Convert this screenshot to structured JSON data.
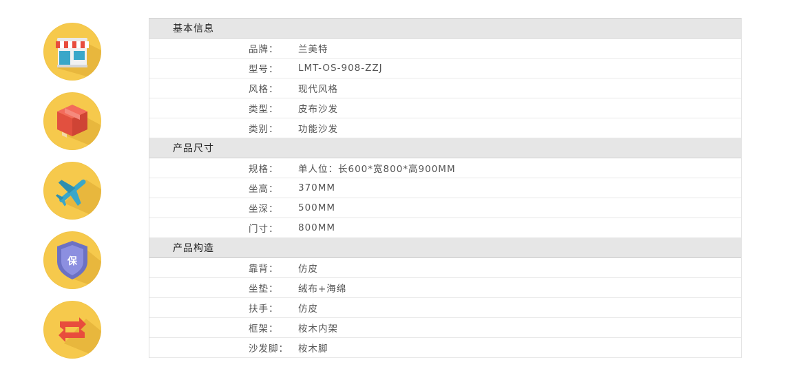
{
  "sidebar": {
    "icons": [
      {
        "name": "store-icon"
      },
      {
        "name": "package-box-icon"
      },
      {
        "name": "airplane-icon"
      },
      {
        "name": "warranty-shield-icon",
        "text": "保"
      },
      {
        "name": "return-exchange-icon"
      }
    ],
    "circle_color": "#f6c94c"
  },
  "sections": [
    {
      "title": "基本信息",
      "rows": [
        {
          "label": "品牌：",
          "value": "兰美特"
        },
        {
          "label": "型号：",
          "value": "LMT-OS-908-ZZJ"
        },
        {
          "label": "风格：",
          "value": "现代风格"
        },
        {
          "label": "类型：",
          "value": "皮布沙发"
        },
        {
          "label": "类别：",
          "value": "功能沙发"
        }
      ]
    },
    {
      "title": "产品尺寸",
      "rows": [
        {
          "label": "规格：",
          "value": "单人位：长600*宽800*高900MM"
        },
        {
          "label": "坐高：",
          "value": "370MM"
        },
        {
          "label": "坐深：",
          "value": "500MM"
        },
        {
          "label": "门寸：",
          "value": "800MM"
        }
      ]
    },
    {
      "title": "产品构造",
      "rows": [
        {
          "label": "靠背：",
          "value": "仿皮"
        },
        {
          "label": "坐垫：",
          "value": "绒布+海绵"
        },
        {
          "label": "扶手：",
          "value": "仿皮"
        },
        {
          "label": "框架：",
          "value": "桉木内架"
        },
        {
          "label": "沙发脚：",
          "value": "桉木脚"
        }
      ]
    }
  ]
}
